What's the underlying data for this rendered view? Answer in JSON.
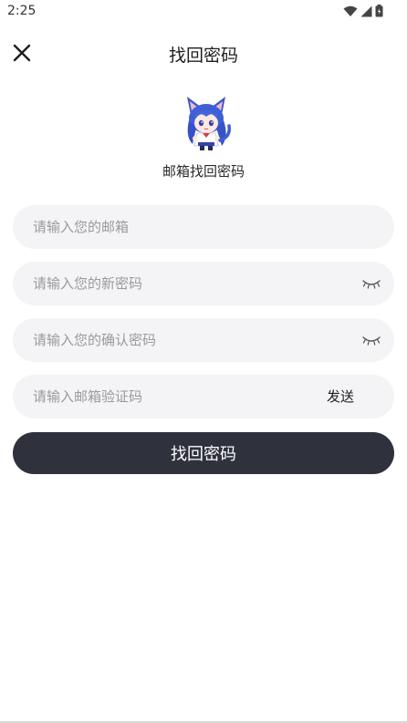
{
  "status_bar": {
    "time": "2:25"
  },
  "header": {
    "title": "找回密码"
  },
  "avatar": {
    "icon": "anime-mascot-icon"
  },
  "subtitle": "邮箱找回密码",
  "form": {
    "email": {
      "placeholder": "请输入您的邮箱",
      "value": ""
    },
    "new_password": {
      "placeholder": "请输入您的新密码",
      "value": ""
    },
    "confirm_password": {
      "placeholder": "请输入您的确认密码",
      "value": ""
    },
    "code": {
      "placeholder": "请输入邮箱验证码",
      "value": ""
    },
    "send_label": "发送"
  },
  "submit_label": "找回密码",
  "colors": {
    "field_bg": "#f4f4f6",
    "button_bg": "#2f323d",
    "button_text": "#ffffff"
  }
}
